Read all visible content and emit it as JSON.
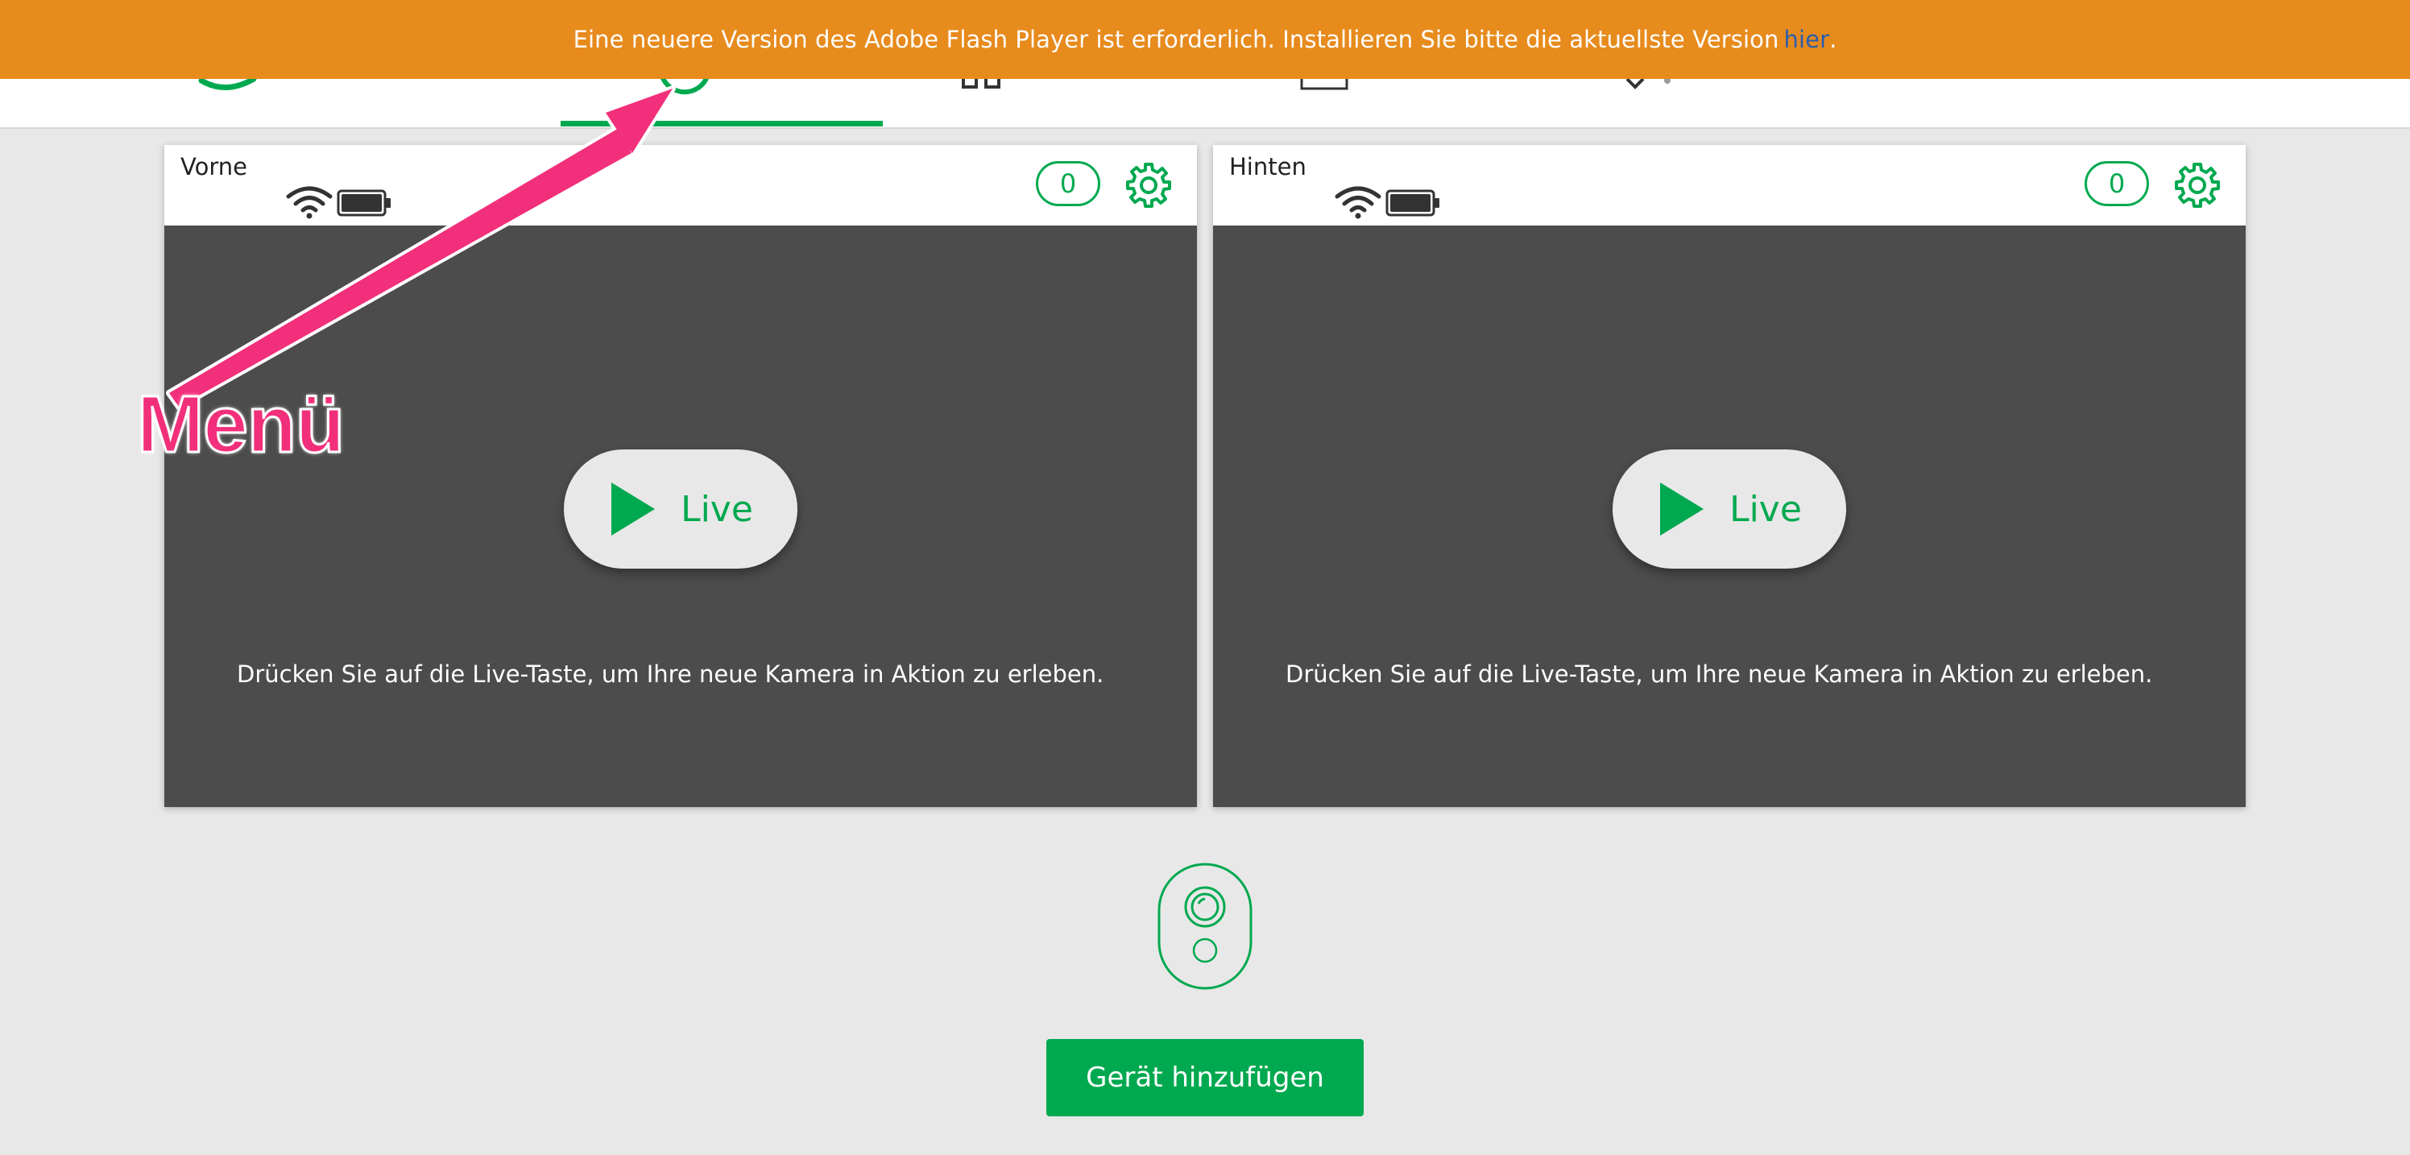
{
  "banner": {
    "message": "Eine neuere Version des Adobe Flash Player ist erforderlich. Installieren Sie bitte die aktuellste Version",
    "link_text": "hier",
    "trailing": "."
  },
  "cameras": [
    {
      "name": "Vorne",
      "count": "0",
      "live_label": "Live",
      "hint": "Drücken Sie auf die Live-Taste, um Ihre neue Kamera in Aktion zu erleben."
    },
    {
      "name": "Hinten",
      "count": "0",
      "live_label": "Live",
      "hint": "Drücken Sie auf die Live-Taste, um Ihre neue Kamera in Aktion zu erleben."
    }
  ],
  "add_device": {
    "label": "Gerät hinzufügen"
  },
  "annotation": {
    "label": "Menü"
  },
  "colors": {
    "brand_green": "#00a94f",
    "banner_orange": "#e78b1d",
    "annotation_pink": "#f22f7b",
    "card_bg": "#4c4c4c"
  },
  "icons": [
    "wifi-icon",
    "battery-icon",
    "gear-icon",
    "play-icon",
    "camera-device-icon"
  ]
}
